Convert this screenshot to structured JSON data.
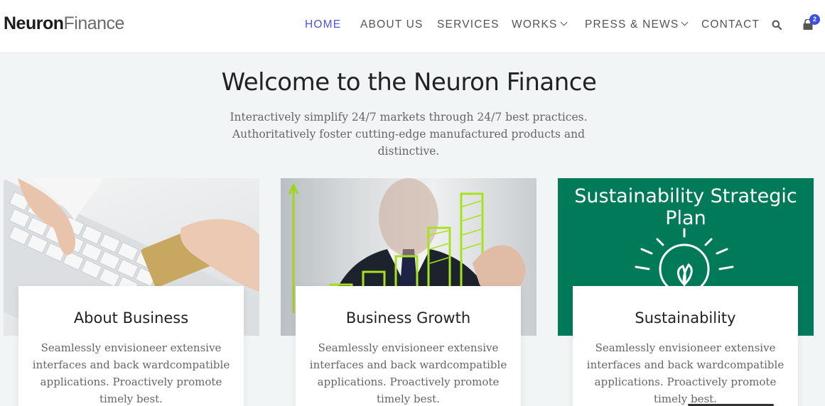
{
  "header": {
    "logo_bold": "Neuron",
    "logo_light": "Finance",
    "nav": [
      {
        "label": "HOME"
      },
      {
        "label": "ABOUT US"
      },
      {
        "label": "SERVICES"
      },
      {
        "label": "WORKS"
      },
      {
        "label": "PRESS & NEWS"
      },
      {
        "label": "CONTACT"
      }
    ],
    "cart_count": "2"
  },
  "hero": {
    "title": "Welcome to the Neuron Finance",
    "text": "Interactively simplify 24/7 markets through 24/7 best practices. Authoritatively foster cutting-edge manufactured products and distinctive."
  },
  "cards": [
    {
      "title": "About Business",
      "text": "Seamlessly envisioneer extensive interfaces and back wardcompatible applications. Proactively promote timely best."
    },
    {
      "title": "Business Growth",
      "text": "Seamlessly envisioneer extensive interfaces and back wardcompatible applications. Proactively promote timely best."
    },
    {
      "title": "Sustainability",
      "text": "Seamlessly envisioneer extensive interfaces and back wardcompatible applications. Proactively promote timely best.",
      "image_text": "Sustainability Strategic Plan"
    }
  ],
  "colors": {
    "accent": "#4a56d9",
    "green": "#007a59"
  },
  "icons": [
    "search-icon",
    "cart-icon",
    "chevron-down-icon"
  ]
}
